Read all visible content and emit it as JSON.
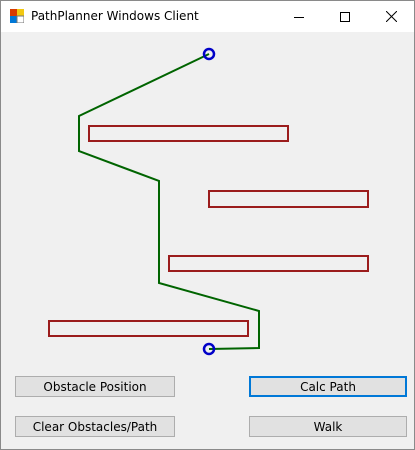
{
  "window": {
    "title": "PathPlanner Windows Client",
    "icons": [
      "app-icon",
      "minimize-icon",
      "maximize-icon",
      "close-icon"
    ]
  },
  "buttons": {
    "obstacle_position": "Obstacle Position",
    "calc_path": "Calc Path",
    "clear": "Clear Obstacles/Path",
    "walk": "Walk"
  },
  "colors": {
    "path": "#006400",
    "obstacle": "#9b1c1c",
    "endpoint": "#0000c8",
    "focus": "#0078d7"
  }
}
